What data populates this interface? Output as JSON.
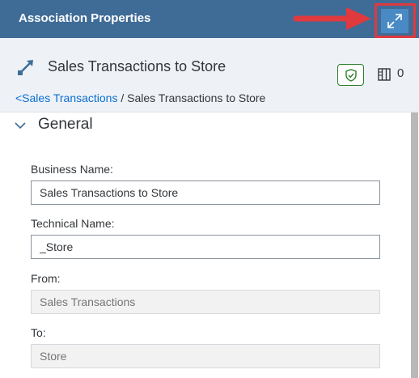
{
  "panel": {
    "title": "Association Properties",
    "expand_icon": "expand-icon"
  },
  "object": {
    "icon": "association-icon",
    "title": "Sales Transactions to Store",
    "status_icon": "shield-check-icon",
    "columns_icon": "columns-icon",
    "column_count": "0"
  },
  "breadcrumb": {
    "link": "<Sales Transactions",
    "separator": " / ",
    "current": "Sales Transactions to Store"
  },
  "section": {
    "title": "General",
    "collapse_icon": "chevron-down-icon"
  },
  "fields": {
    "business_name": {
      "label": "Business Name:",
      "value": "Sales Transactions to Store"
    },
    "technical_name": {
      "label": "Technical Name:",
      "value": "_Store"
    },
    "from": {
      "label": "From:",
      "placeholder": "Sales Transactions"
    },
    "to": {
      "label": "To:",
      "placeholder": "Store"
    }
  },
  "colors": {
    "header_bg": "#3f6c97",
    "expand_button": "#4a8ac4",
    "highlight": "#e0393e",
    "link": "#0a6ed1",
    "status_border": "#2b7d2b"
  }
}
